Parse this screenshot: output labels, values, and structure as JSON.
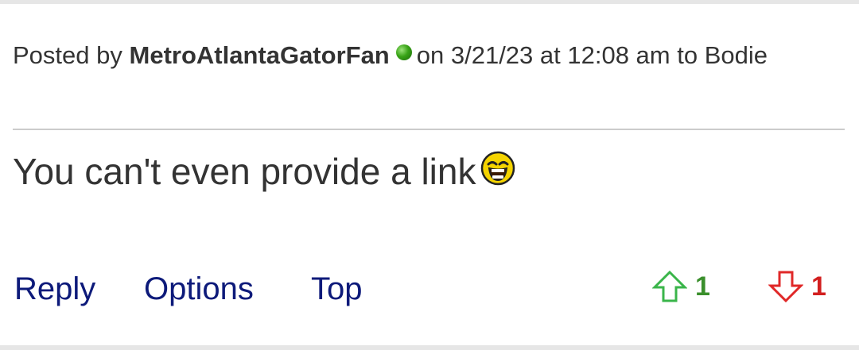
{
  "post": {
    "posted_by_label": "Posted by",
    "author": "MetroAtlantaGatorFan",
    "timestamp_prefix": "on",
    "timestamp": "3/21/23 at 12:08 am",
    "to_label": "to",
    "recipient": "Bodie",
    "body": "You can't even provide a link",
    "emoji": "laughing-face-icon"
  },
  "actions": {
    "reply_label": "Reply",
    "options_label": "Options",
    "top_label": "Top"
  },
  "votes": {
    "up_count": "1",
    "down_count": "1",
    "up_color": "#3a8f2c",
    "down_color": "#d21f1f"
  },
  "colors": {
    "link": "#0d1a7a",
    "text": "#333333",
    "online_dot": "#38a316"
  }
}
